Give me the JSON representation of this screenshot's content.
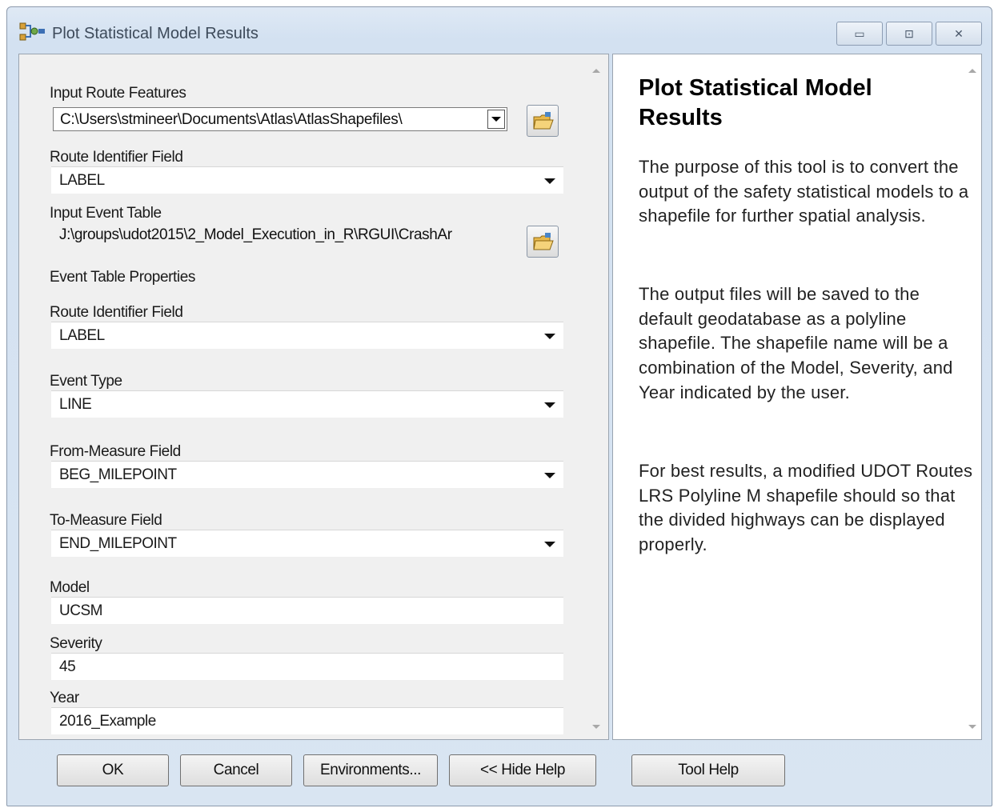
{
  "window": {
    "title": "Plot Statistical Model Results",
    "controls": {
      "minimize": "▭",
      "maximize": "⊡",
      "close": "✕"
    }
  },
  "form": {
    "input_route_features": {
      "label": "Input Route Features",
      "value": "C:\\Users\\stmineer\\Documents\\Atlas\\AtlasShapefiles\\"
    },
    "route_identifier_field": {
      "label": "Route Identifier Field",
      "value": "LABEL"
    },
    "input_event_table": {
      "label": "Input Event Table",
      "value": "J:\\groups\\udot2015\\2_Model_Execution_in_R\\RGUI\\CrashAr"
    },
    "event_table_properties_label": "Event Table Properties",
    "event_route_identifier_field": {
      "label": "Route Identifier Field",
      "value": "LABEL"
    },
    "event_type": {
      "label": "Event Type",
      "value": "LINE"
    },
    "from_measure_field": {
      "label": "From-Measure Field",
      "value": "BEG_MILEPOINT"
    },
    "to_measure_field": {
      "label": "To-Measure Field",
      "value": "END_MILEPOINT"
    },
    "model": {
      "label": "Model",
      "value": "UCSM"
    },
    "severity": {
      "label": "Severity",
      "value": "45"
    },
    "year": {
      "label": "Year",
      "value": "2016_Example"
    }
  },
  "help": {
    "title": "Plot Statistical Model Results",
    "paragraphs": [
      "The purpose of this tool is to convert the output of the safety statistical models to a shapefile for further spatial analysis.",
      "The output files will be saved to the default geodatabase as a polyline shapefile. The shapefile name will be a combination of the Model, Severity, and Year indicated by the user.",
      "For best results, a modified UDOT Routes LRS Polyline M shapefile should so that the divided highways can be displayed properly."
    ]
  },
  "buttons": {
    "ok": "OK",
    "cancel": "Cancel",
    "environments": "Environments...",
    "hide_help": "<< Hide Help",
    "tool_help": "Tool Help"
  }
}
